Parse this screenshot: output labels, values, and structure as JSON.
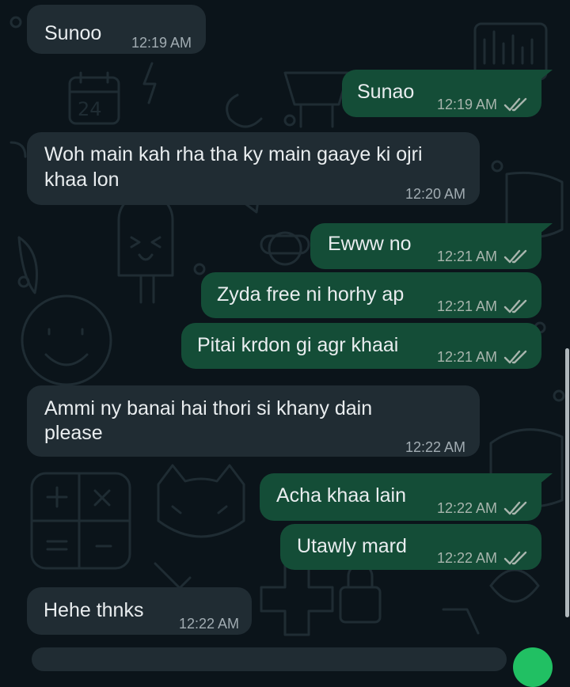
{
  "messages": [
    {
      "text": "Sunoo",
      "time": "12:19 AM",
      "direction": "incoming"
    },
    {
      "text": "Sunao",
      "time": "12:19 AM",
      "direction": "outgoing",
      "status": "read"
    },
    {
      "text": "Woh main kah rha tha ky main gaaye ki ojri",
      "text2": "khaa lon",
      "time": "12:20 AM",
      "direction": "incoming"
    },
    {
      "text": "Ewww no",
      "time": "12:21 AM",
      "direction": "outgoing",
      "status": "read"
    },
    {
      "text": "Zyda free ni horhy ap",
      "time": "12:21 AM",
      "direction": "outgoing",
      "status": "read"
    },
    {
      "text": "Pitai krdon gi agr khaai",
      "time": "12:21 AM",
      "direction": "outgoing",
      "status": "read"
    },
    {
      "text": "Ammi ny banai hai thori si khany dain",
      "text2": "please",
      "time": "12:22 AM",
      "direction": "incoming"
    },
    {
      "text": "Acha khaa lain",
      "time": "12:22 AM",
      "direction": "outgoing",
      "status": "read"
    },
    {
      "text": "Utawly mard",
      "time": "12:22 AM",
      "direction": "outgoing",
      "status": "read"
    },
    {
      "text": "Hehe thnks",
      "time": "12:22 AM",
      "direction": "incoming"
    }
  ],
  "colors": {
    "background": "#0b141a",
    "incoming_bubble": "#202c33",
    "outgoing_bubble": "#144d37",
    "text": "#e9edef",
    "timestamp": "#a8b5ad",
    "read_tick": "#a8b5ad"
  },
  "icons": {
    "read_receipt": "double-check-icon",
    "wallpaper": "doodle-pattern"
  }
}
